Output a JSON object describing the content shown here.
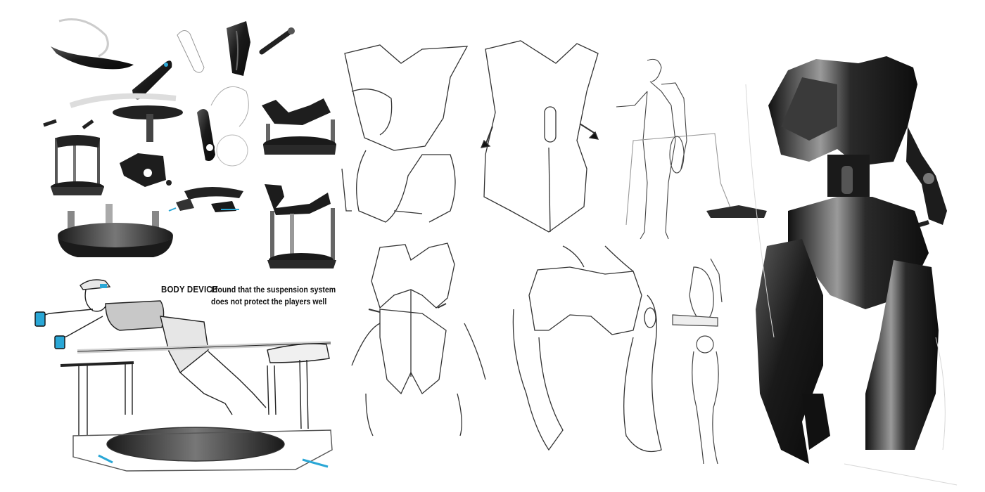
{
  "annotations": {
    "body_device": "BODY DEVICE",
    "note_line_1": "I found that the suspension system",
    "note_line_2": "does not protect the players well"
  },
  "colors": {
    "background": "#ffffff",
    "ink": "#1a1a1a",
    "accent": "#2aa7d6",
    "render_dark": "#1b1b1b",
    "render_mid": "#6b6b6b",
    "render_light": "#d0d0d0"
  },
  "icons": [
    "motion-platform-render",
    "harness-part-render",
    "rider-on-platform-sketch",
    "torso-exoskeleton-sketch",
    "standing-figure-sketch",
    "body-device-render"
  ]
}
